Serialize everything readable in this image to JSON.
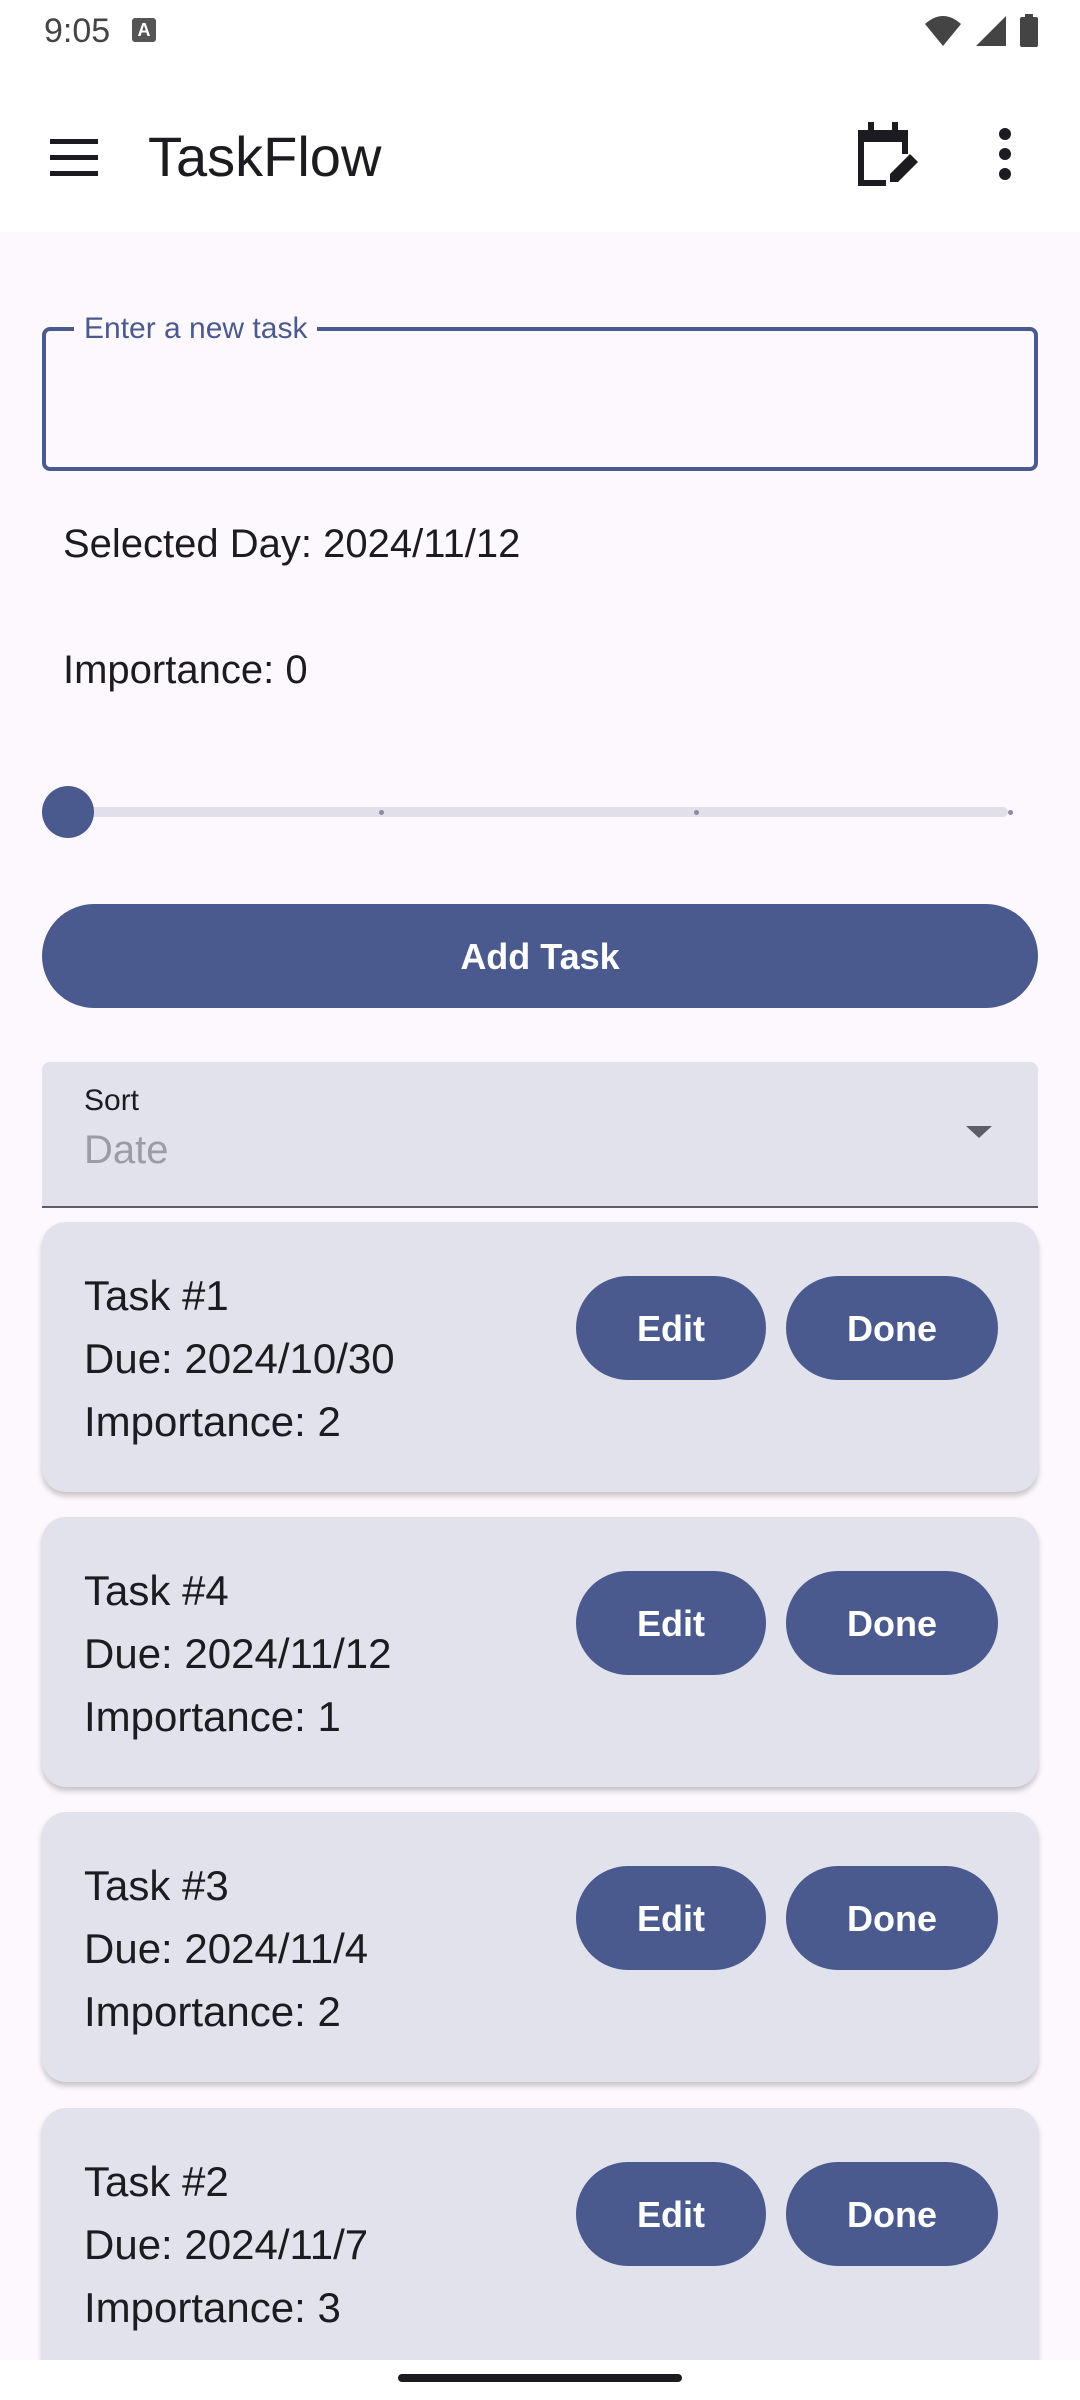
{
  "status_bar": {
    "time": "9:05",
    "notification_icon": "a-icon"
  },
  "app_bar": {
    "title": "TaskFlow",
    "menu_icon": "hamburger-menu-icon",
    "calendar_icon": "edit-calendar-icon",
    "more_icon": "more-vert-icon"
  },
  "task_input": {
    "label": "Enter a new task",
    "value": ""
  },
  "selected_day": "Selected Day: 2024/11/12",
  "importance": {
    "label": "Importance: 0",
    "value": 0,
    "max": 3
  },
  "add_task_label": "Add Task",
  "sort": {
    "label": "Sort",
    "value": "Date"
  },
  "tasks": [
    {
      "name": "Task #1",
      "due": "Due: 2024/10/30",
      "importance": "Importance: 2",
      "edit_label": "Edit",
      "done_label": "Done"
    },
    {
      "name": "Task #4",
      "due": "Due: 2024/11/12",
      "importance": "Importance: 1",
      "edit_label": "Edit",
      "done_label": "Done"
    },
    {
      "name": "Task #3",
      "due": "Due: 2024/11/4",
      "importance": "Importance: 2",
      "edit_label": "Edit",
      "done_label": "Done"
    },
    {
      "name": "Task #2",
      "due": "Due: 2024/11/7",
      "importance": "Importance: 3",
      "edit_label": "Edit",
      "done_label": "Done"
    }
  ],
  "colors": {
    "primary": "#4a5a8f",
    "card_background": "#e1e2ec",
    "page_background": "#fdf8fd"
  }
}
